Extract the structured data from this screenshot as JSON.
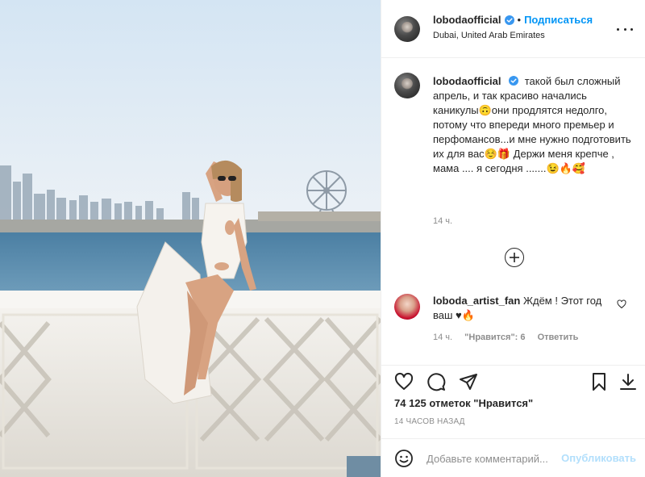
{
  "header": {
    "username": "lobodaofficial",
    "separator": "•",
    "follow_label": "Подписаться",
    "location": "Dubai, United Arab Emirates"
  },
  "caption": {
    "username": "lobodaofficial",
    "text": "такой был сложный апрель, и так красиво начались каникулы🙃они продлятся недолго, потому что впереди много премьер и перфомансов...и мне нужно подготовить их для вас☺️🎁 Держи меня крепче , мама .... я сегодня .......😉🔥🥰",
    "time": "14 ч."
  },
  "comment": {
    "username": "loboda_artist_fan",
    "text": "Ждём ! Этот год ваш ♥🔥",
    "time": "14 ч.",
    "likes": "\"Нравится\": 6",
    "reply_label": "Ответить"
  },
  "likes": "74 125 отметок \"Нравится\"",
  "posted_ago": "14 ЧАСОВ НАЗАД",
  "add_comment": {
    "placeholder": "Добавьте комментарий...",
    "publish_label": "Опубликовать"
  },
  "icons": {
    "verified": "verified-badge-icon",
    "more": "more-options-icon",
    "load_more": "plus-circle-icon",
    "comment_like": "heart-outline-icon",
    "like": "heart-outline-icon",
    "comment": "speech-bubble-icon",
    "share": "paper-plane-icon",
    "save": "bookmark-icon",
    "download": "download-icon",
    "emoji": "smiley-icon"
  },
  "colors": {
    "link_blue": "#0095f6",
    "verified_blue": "#3897f0",
    "publish_disabled": "#b2dffc",
    "muted_text": "#8e8e8e",
    "text": "#262626"
  }
}
